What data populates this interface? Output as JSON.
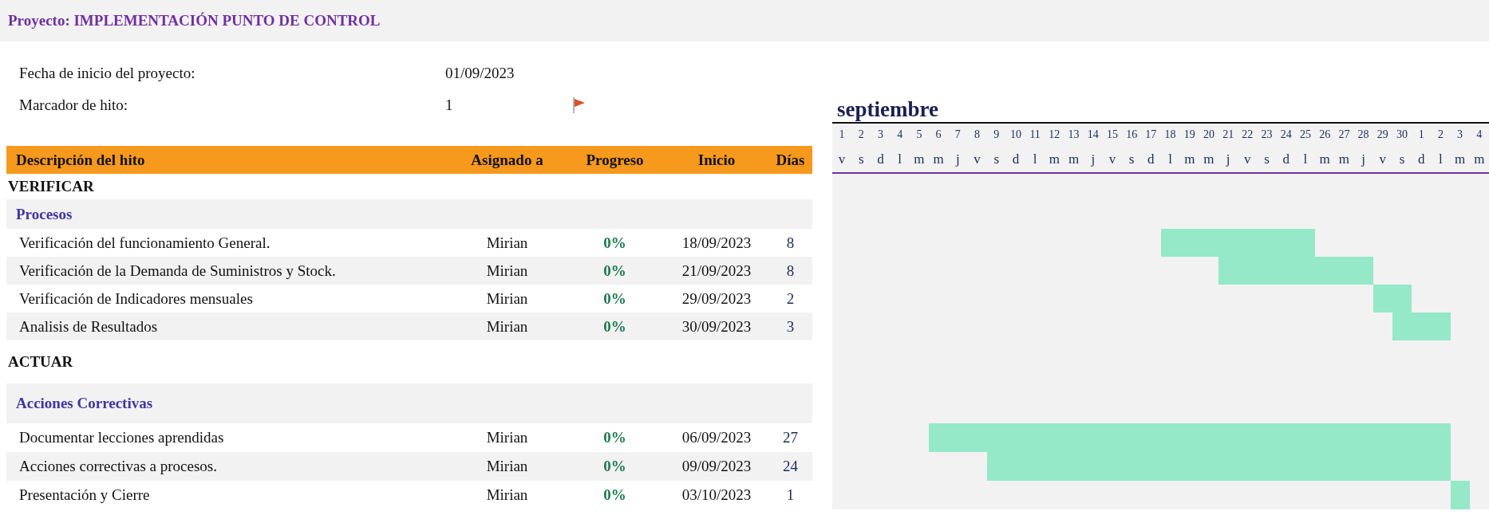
{
  "project_title": "Proyecto: IMPLEMENTACIÓN PUNTO DE CONTROL",
  "project_start": {
    "label": "Fecha de inicio del proyecto:",
    "value": "01/09/2023"
  },
  "milestone_marker": {
    "label": "Marcador de hito:",
    "value": "1"
  },
  "columns": [
    "Descripción del hito",
    "Asignado a",
    "Progreso",
    "Inicio",
    "Días"
  ],
  "timeline": {
    "month": "septiembre",
    "days": [
      {
        "day": "1",
        "weekday": "v"
      },
      {
        "day": "2",
        "weekday": "s"
      },
      {
        "day": "3",
        "weekday": "d"
      },
      {
        "day": "4",
        "weekday": "l"
      },
      {
        "day": "5",
        "weekday": "m"
      },
      {
        "day": "6",
        "weekday": "m"
      },
      {
        "day": "7",
        "weekday": "j"
      },
      {
        "day": "8",
        "weekday": "v"
      },
      {
        "day": "9",
        "weekday": "s"
      },
      {
        "day": "10",
        "weekday": "d"
      },
      {
        "day": "11",
        "weekday": "l"
      },
      {
        "day": "12",
        "weekday": "m"
      },
      {
        "day": "13",
        "weekday": "m"
      },
      {
        "day": "14",
        "weekday": "j"
      },
      {
        "day": "15",
        "weekday": "v"
      },
      {
        "day": "16",
        "weekday": "s"
      },
      {
        "day": "17",
        "weekday": "d"
      },
      {
        "day": "18",
        "weekday": "l"
      },
      {
        "day": "19",
        "weekday": "m"
      },
      {
        "day": "20",
        "weekday": "m"
      },
      {
        "day": "21",
        "weekday": "j"
      },
      {
        "day": "22",
        "weekday": "v"
      },
      {
        "day": "23",
        "weekday": "s"
      },
      {
        "day": "24",
        "weekday": "d"
      },
      {
        "day": "25",
        "weekday": "l"
      },
      {
        "day": "26",
        "weekday": "m"
      },
      {
        "day": "27",
        "weekday": "m"
      },
      {
        "day": "28",
        "weekday": "j"
      },
      {
        "day": "29",
        "weekday": "v"
      },
      {
        "day": "30",
        "weekday": "s"
      },
      {
        "day": "1",
        "weekday": "d"
      },
      {
        "day": "2",
        "weekday": "l"
      },
      {
        "day": "3",
        "weekday": "m"
      },
      {
        "day": "4",
        "weekday": "m"
      }
    ]
  },
  "phases": [
    {
      "title": "VERIFICAR",
      "groups": [
        {
          "title": "Procesos",
          "tasks": [
            {
              "name": "Verificación del funcionamiento General.",
              "assigned": "Mirian",
              "progress": "0%",
              "start": "18/09/2023",
              "days": "8"
            },
            {
              "name": "Verificación de la Demanda de Suministros y Stock.",
              "assigned": "Mirian",
              "progress": "0%",
              "start": "21/09/2023",
              "days": "8"
            },
            {
              "name": "Verificación de Indicadores mensuales",
              "assigned": "Mirian",
              "progress": "0%",
              "start": "29/09/2023",
              "days": "2"
            },
            {
              "name": "Analisis de Resultados",
              "assigned": "Mirian",
              "progress": "0%",
              "start": "30/09/2023",
              "days": "3"
            }
          ]
        }
      ]
    },
    {
      "title": "ACTUAR",
      "groups": [
        {
          "title": "Acciones Correctivas",
          "tasks": [
            {
              "name": "Documentar lecciones aprendidas",
              "assigned": "Mirian",
              "progress": "0%",
              "start": "06/09/2023",
              "days": "27"
            },
            {
              "name": "Acciones correctivas a procesos.",
              "assigned": "Mirian",
              "progress": "0%",
              "start": "09/09/2023",
              "days": "24"
            },
            {
              "name": "Presentación y Cierre",
              "assigned": "Mirian",
              "progress": "0%",
              "start": "03/10/2023",
              "days": "1"
            }
          ]
        }
      ]
    }
  ]
}
